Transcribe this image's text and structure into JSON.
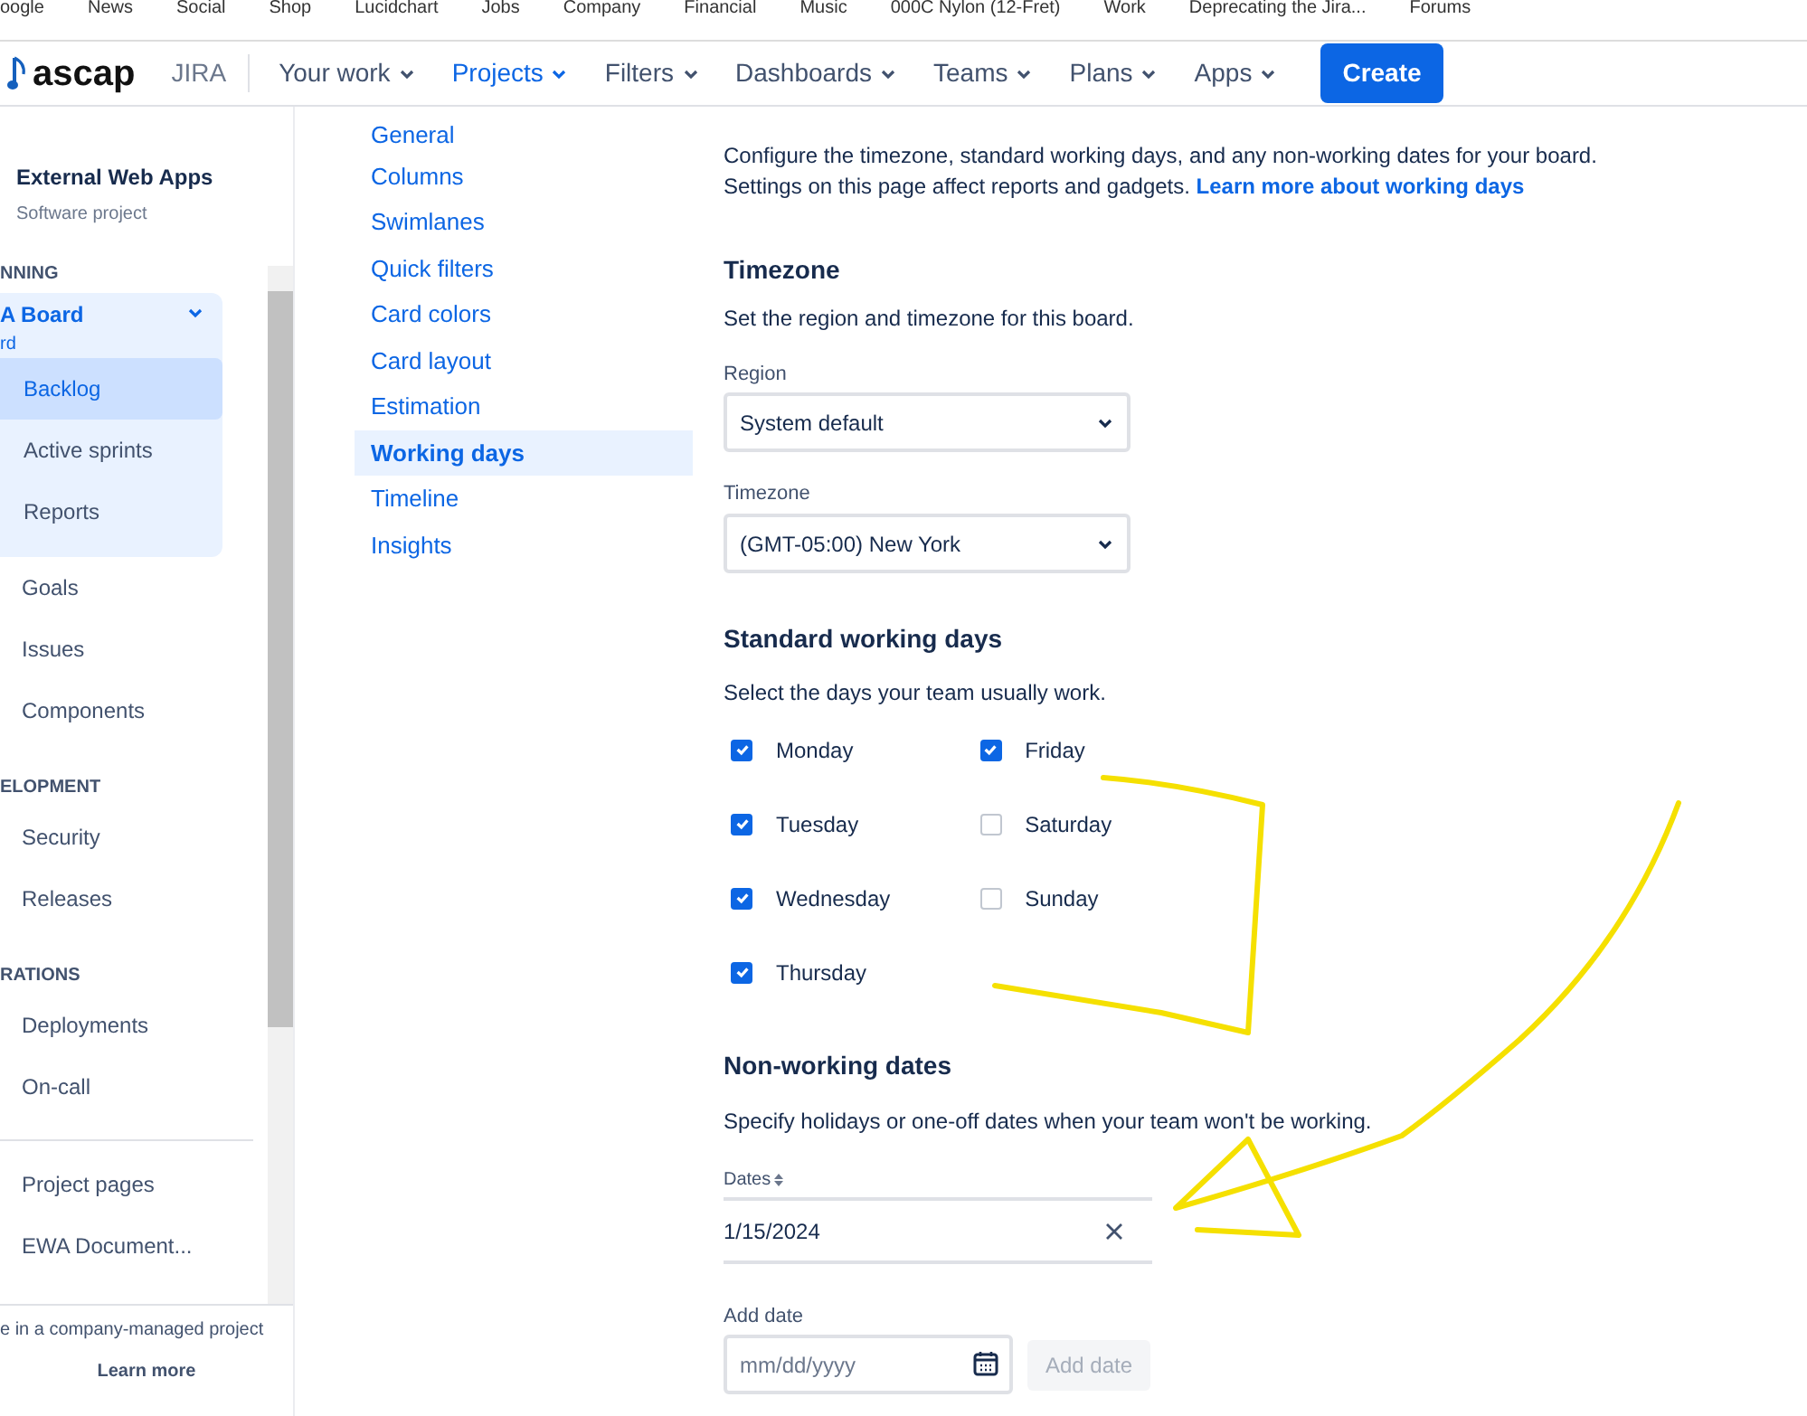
{
  "bookmarks": [
    "oogle",
    "News",
    "Social",
    "Shop",
    "Lucidchart",
    "Jobs",
    "Company",
    "Financial",
    "Music",
    "000C Nylon (12-Fret)",
    "Work",
    "Deprecating the Jira...",
    "Forums"
  ],
  "nav": {
    "logo": "ascap",
    "product": "JIRA",
    "menus": [
      {
        "label": "Your work",
        "selected": false
      },
      {
        "label": "Projects",
        "selected": true
      },
      {
        "label": "Filters",
        "selected": false
      },
      {
        "label": "Dashboards",
        "selected": false
      },
      {
        "label": "Teams",
        "selected": false
      },
      {
        "label": "Plans",
        "selected": false
      },
      {
        "label": "Apps",
        "selected": false
      }
    ],
    "create": "Create"
  },
  "sidebar": {
    "project": "External Web Apps",
    "project_type": "Software project",
    "sections": [
      {
        "heading": "NNING",
        "board": {
          "title": "A Board",
          "subtitle": "rd",
          "expanded": true,
          "items": [
            {
              "label": "Backlog",
              "selected": true
            },
            {
              "label": "Active sprints",
              "selected": false
            },
            {
              "label": "Reports",
              "selected": false
            }
          ]
        },
        "items": [
          "Goals",
          "Issues",
          "Components"
        ]
      },
      {
        "heading": "ELOPMENT",
        "items": [
          "Security",
          "Releases"
        ]
      },
      {
        "heading": "RATIONS",
        "items": [
          "Deployments",
          "On-call"
        ]
      },
      {
        "items": [
          "Project pages",
          "EWA Document..."
        ]
      }
    ],
    "footer": "e in a company-managed project",
    "footer_link": "Learn more"
  },
  "settings_nav": [
    {
      "label": "General",
      "selected": false
    },
    {
      "label": "Columns",
      "selected": false
    },
    {
      "label": "Swimlanes",
      "selected": false
    },
    {
      "label": "Quick filters",
      "selected": false
    },
    {
      "label": "Card colors",
      "selected": false
    },
    {
      "label": "Card layout",
      "selected": false
    },
    {
      "label": "Estimation",
      "selected": false
    },
    {
      "label": "Working days",
      "selected": true
    },
    {
      "label": "Timeline",
      "selected": false
    },
    {
      "label": "Insights",
      "selected": false
    }
  ],
  "intro": "Configure the timezone, standard working days, and any non-working dates for your board. Settings on this page affect reports and gadgets.",
  "intro_link": "Learn more about working days",
  "timezone": {
    "title": "Timezone",
    "description": "Set the region and timezone for this board.",
    "region_label": "Region",
    "region": "System default",
    "timezone_label": "Timezone",
    "timezone": "(GMT-05:00) New York"
  },
  "working_days": {
    "title": "Standard working days",
    "description": "Select the days your team usually work.",
    "days": [
      {
        "label": "Monday",
        "checked": true
      },
      {
        "label": "Tuesday",
        "checked": true
      },
      {
        "label": "Wednesday",
        "checked": true
      },
      {
        "label": "Thursday",
        "checked": true
      },
      {
        "label": "Friday",
        "checked": true
      },
      {
        "label": "Saturday",
        "checked": false
      },
      {
        "label": "Sunday",
        "checked": false
      }
    ]
  },
  "non_working": {
    "title": "Non-working dates",
    "description": "Specify holidays or one-off dates when your team won't be working.",
    "column": "Dates",
    "dates": [
      "1/15/2024"
    ],
    "add_label": "Add date",
    "placeholder": "mm/dd/yyyy",
    "add_button": "Add date"
  }
}
